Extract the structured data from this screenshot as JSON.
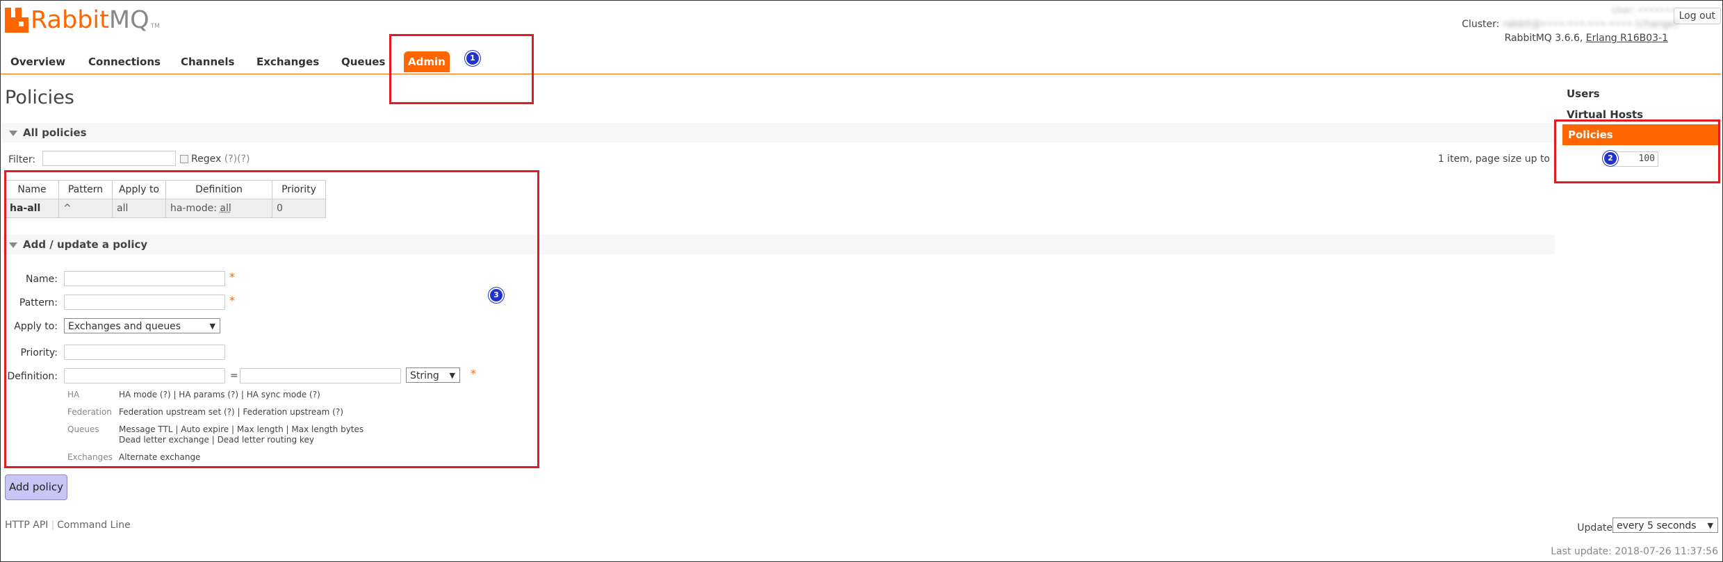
{
  "header": {
    "logo_main": "Rabbit",
    "logo_accent": "MQ",
    "logo_tm": "TM",
    "user": "User: ••••••••",
    "logout": "Log out",
    "cluster_label": "Cluster:",
    "cluster_value": "rabbit@••••-•••-•••-•••• (change)",
    "version": "RabbitMQ 3.6.6,",
    "erlang": "Erlang R16B03-1"
  },
  "nav": {
    "tabs": [
      "Overview",
      "Connections",
      "Channels",
      "Exchanges",
      "Queues",
      "Admin"
    ],
    "active": "Admin"
  },
  "page": {
    "title": "Policies"
  },
  "all_policies": {
    "header": "All policies",
    "filter_label": "Filter:",
    "regex_label": "Regex",
    "regex_help": "(?)(?)",
    "page_info": "1 item, page size up to",
    "page_size": "100",
    "columns": [
      "Name",
      "Pattern",
      "Apply to",
      "Definition",
      "Priority"
    ],
    "rows": [
      {
        "name": "ha-all",
        "pattern": "^",
        "apply_to": "all",
        "def_key": "ha-mode:",
        "def_val": "all",
        "priority": "0"
      }
    ]
  },
  "add_policy": {
    "header": "Add / update a policy",
    "name_label": "Name:",
    "pattern_label": "Pattern:",
    "apply_label": "Apply to:",
    "apply_value": "Exchanges and queues",
    "priority_label": "Priority:",
    "definition_label": "Definition:",
    "equals": "=",
    "type_value": "String",
    "required_mark": "*",
    "hints": [
      {
        "cat": "HA",
        "line1": "HA mode (?) | HA params (?) | HA sync mode (?)",
        "line2": ""
      },
      {
        "cat": "Federation",
        "line1": "Federation upstream set (?) | Federation upstream (?)",
        "line2": ""
      },
      {
        "cat": "Queues",
        "line1": "Message TTL | Auto expire | Max length | Max length bytes",
        "line2": "Dead letter exchange | Dead letter routing key"
      },
      {
        "cat": "Exchanges",
        "line1": "Alternate exchange",
        "line2": ""
      }
    ],
    "submit": "Add policy"
  },
  "sidebar": {
    "items": [
      "Users",
      "Virtual Hosts",
      "Policies"
    ],
    "active": "Policies"
  },
  "footer": {
    "http_api": "HTTP API",
    "command_line": "Command Line",
    "update_label": "Update",
    "update_value": "every 5 seconds",
    "last_update": "Last update: 2018-07-26 11:37:56"
  },
  "annotations": {
    "markers": [
      "1",
      "2",
      "3"
    ]
  },
  "colors": {
    "accent": "#ff6600",
    "annotation_red": "#e01b22",
    "marker_blue": "#2233cc",
    "button_bg": "#c9c5f5"
  }
}
